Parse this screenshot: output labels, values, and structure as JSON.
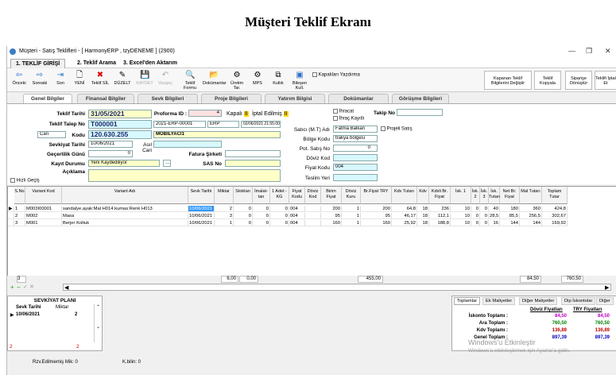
{
  "page_heading": "Müşteri Teklif Ekranı",
  "window": {
    "title": "Müşteri - Satış Teklifleri - [ HarmonyERP , tzyDENEME ]  (2900)",
    "minimize": "—",
    "maximize": "❐",
    "close": "✕"
  },
  "main_tabs": [
    "1. TEKLİF GİRİŞİ",
    "2. Teklif Arama",
    "3. Excel'den Aktarım"
  ],
  "toolbar": {
    "buttons": [
      {
        "label": "Önceki",
        "icon": "⇦"
      },
      {
        "label": "Sonraki",
        "icon": "⇨"
      },
      {
        "label": "Son",
        "icon": "⇥"
      },
      {
        "label": "YENİ",
        "icon": "🗋"
      },
      {
        "label": "Teklif SİL",
        "icon": "✖"
      },
      {
        "label": "DÜZELT",
        "icon": "✎"
      },
      {
        "label": "KAYDET",
        "icon": "💾"
      },
      {
        "label": "Vazgeç",
        "icon": "↶"
      },
      {
        "label": "Teklif Formu",
        "icon": "🔍"
      },
      {
        "label": "Dokümanlar",
        "icon": "📂"
      },
      {
        "label": "Üretim Tar.",
        "icon": "⚙"
      },
      {
        "label": "MPS",
        "icon": "⚙"
      },
      {
        "label": "Kullık",
        "icon": "⧉"
      },
      {
        "label": "Bileşen Kull.",
        "icon": "▣"
      }
    ],
    "print_checkbox": "Kapalıları Yazdırma",
    "right_buttons": [
      {
        "label": "Kapanan Teklif Bilgilerini Değiştir"
      },
      {
        "label": "Teklif Kopyala"
      },
      {
        "label": "Siparişe Dönüştür"
      },
      {
        "label": "Teklifi İptal Et"
      }
    ]
  },
  "sub_tabs": [
    "Genel Bilgiler",
    "Finansal Bilgiler",
    "Sevk Bilgileri",
    "Proje Bilgileri",
    "Yatırım Bilgisi",
    "Dokümanlar",
    "Görüşme Bilgileri"
  ],
  "form": {
    "teklif_tarihi_label": "Teklif Tarihi",
    "teklif_tarihi": "31/05/2021",
    "proforma_label": "Proforma ID :",
    "proforma_value": "4",
    "kapali_label": "Kapalı",
    "iptal_label": "İptal Edilmiş",
    "teklif_talep_label": "Teklif Talep No",
    "teklif_talep_no": "T000001",
    "talep_ref": "2021-ERP-00001",
    "erp_label": "ERP",
    "erp_date": "02/06/2021 21:55:00",
    "cari_tipi": "Cari",
    "kodu_label": "Kodu",
    "kodu": "120.630.255",
    "firma": "MOBILYACI1",
    "sevkiyat_label": "Sevkiyat Tarihi",
    "sevkiyat_tarihi": "10/06/2021",
    "asil_cari_label": "Asıl Cari",
    "gecerlilik_label": "Geçerlilik Günü",
    "gecerlilik": "0",
    "fatura_label": "Fatura Şirketi",
    "kayit_label": "Kayıt Durumu",
    "kayit_durumu": "Yeni Kaydediliyor",
    "sas_label": "SAS No",
    "aciklama_label": "Açıklama",
    "hizli_gecis": "Hızlı Geçiş",
    "ihracat": "İhracat",
    "ihrac_kayitli": "İhraç Kayıtlı",
    "takip_label": "Takip No",
    "satici_label": "Satıcı (M.T) Adı",
    "satici": "Fatma Balkan",
    "projeli_satis": "Projeli Satış",
    "bolge_label": "Bölge Kodu",
    "bolge": "trakya bölgesi",
    "pot_satis_label": "Pot. Satış No",
    "pot_satis": "0",
    "doviz_label": "Döviz Kod",
    "fiyat_label": "Fiyat Kodu",
    "fiyat_kodu": "004",
    "teslim_label": "Teslim Yeri"
  },
  "grid": {
    "headers": [
      "S.No",
      "Variant Kod",
      "Variant Adı",
      "Sevk Tarihi",
      "Miktar",
      "Stoktan",
      "İmalat-tan",
      "1 Adet - KG",
      "Fiyat Kodu",
      "Döviz Kod",
      "Birim Fiyat",
      "Döviz Kuru",
      "Br.Fiyat TRY",
      "Kdv Tutarı",
      "Kdv",
      "Kdvli Br. Fiyat",
      "İsk. 1",
      "İsk. 2",
      "İsk. 3",
      "İsk. Tutarı",
      "Net Br. Fiyat",
      "Mal Tutarı",
      "Toplam Tutar"
    ],
    "rows": [
      [
        "1",
        "M003I00001",
        "sandalye,ayak:Mal H014.kumas:Renk H013",
        "10/06/2021",
        "2",
        "0",
        "0",
        "0",
        "004",
        "",
        "200",
        "1",
        "200",
        "64,8",
        "18",
        "236",
        "10",
        "0",
        "0",
        "40",
        "180",
        "360",
        "424,8"
      ],
      [
        "2",
        "M002",
        "Masa",
        "10/06/2021",
        "3",
        "0",
        "0",
        "0",
        "004",
        "",
        "95",
        "1",
        "95",
        "46,17",
        "18",
        "112,1",
        "10",
        "0",
        "0",
        "28,5",
        "85,5",
        "256,5",
        "302,67"
      ],
      [
        "3",
        "M001",
        "Berjer Koltuk",
        "10/06/2021",
        "1",
        "0",
        "0",
        "0",
        "004",
        "",
        "160",
        "1",
        "160",
        "25,92",
        "18",
        "188,8",
        "10",
        "0",
        "0",
        "16",
        "144",
        "144",
        "169,92"
      ]
    ],
    "summary": {
      "count": "3",
      "miktar": "6,00",
      "stoktan": "0,00",
      "birim": "455,00",
      "isk": "84,50",
      "mal": "760,50"
    }
  },
  "plan": {
    "title": "SEVKİYAT PLANI",
    "col1": "Sevk Tarihi",
    "col2": "Miktar",
    "row_date": "10/06/2021",
    "row_qty": "2",
    "foot_left": "2",
    "foot_right": "2"
  },
  "totals": {
    "tabs": [
      "Toplamlar",
      "Ek Maliyetler",
      "Diğer Maliyetler",
      "Dip İskontolar",
      "Diğer"
    ],
    "col_doviz": "Döviz Fiyatları",
    "col_try": "TRY Fiyatları",
    "rows": [
      {
        "label": "İskonto Toplamı :",
        "doviz": "84,50",
        "try": "84,50"
      },
      {
        "label": "Ara Toplam :",
        "doviz": "760,50",
        "try": "760,50"
      },
      {
        "label": "Kdv Toplamı :",
        "doviz": "136,89",
        "try": "136,89"
      },
      {
        "label": "Genel Toplam :",
        "doviz": "897,39",
        "try": "897,39"
      }
    ],
    "colors": {
      "iskonto": "#c000c0",
      "ara": "#008000",
      "kdv": "#c00000",
      "genel": "#0000c0"
    }
  },
  "status": {
    "rez": "Rzv.Edilmemiş Mik: 0",
    "kbilin": "K.bilin: 0"
  },
  "watermark": {
    "line1": "Windows'u Etkinleştir",
    "line2": "Windows'u etkinleştirmek için Ayarlar'a gidin."
  }
}
